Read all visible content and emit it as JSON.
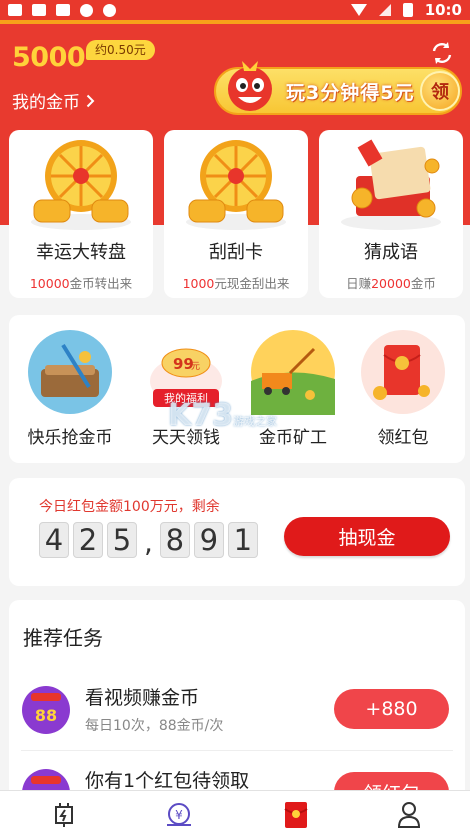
{
  "status_bar": {
    "time": "10:0"
  },
  "header": {
    "coins": "5000",
    "approx": "约0.50元",
    "my_coins_label": "我的金币",
    "promo_text": "玩3分钟得5元",
    "promo_claim": "领",
    "accent": "#e83a2f"
  },
  "games": [
    {
      "title": "幸运大转盘",
      "sub_highlight": "10000",
      "sub_rest": "金币转出来",
      "icon": "lucky-wheel-icon"
    },
    {
      "title": "刮刮卡",
      "sub_highlight": "1000",
      "sub_rest": "元现金刮出来",
      "icon": "scratch-card-icon"
    },
    {
      "title": "猜成语",
      "sub_prefix": "日赚",
      "sub_highlight": "20000",
      "sub_rest": "金币",
      "icon": "idiom-guess-icon"
    }
  ],
  "features": [
    {
      "label": "快乐抢金币",
      "icon": "grab-coins-icon"
    },
    {
      "label": "天天领钱",
      "icon": "daily-money-icon",
      "badge_amount": "99",
      "badge_unit": "元",
      "ribbon": "我的福利"
    },
    {
      "label": "金币矿工",
      "icon": "coin-miner-icon"
    },
    {
      "label": "领红包",
      "icon": "red-packet-icon"
    }
  ],
  "red_pool": {
    "note": "今日红包金额100万元，剩余",
    "digits_a": [
      "4",
      "2",
      "5"
    ],
    "separator": ",",
    "digits_b": [
      "8",
      "9",
      "1"
    ],
    "button": "抽现金"
  },
  "tasks": {
    "title": "推荐任务",
    "items": [
      {
        "name": "看视频赚金币",
        "desc": "每日10次，88金币/次",
        "button": "+880",
        "icon": "video-88-icon",
        "badge": "88"
      },
      {
        "name": "你有1个红包待领取",
        "desc": "",
        "button": "领红包",
        "icon": "red-packet-task-icon"
      }
    ]
  },
  "watermark": {
    "text": "K73",
    "small": "游戏之家"
  },
  "tabs": [
    "earn-tab-icon",
    "coin-exchange-tab-icon",
    "red-packet-tab-icon",
    "profile-tab-icon"
  ]
}
